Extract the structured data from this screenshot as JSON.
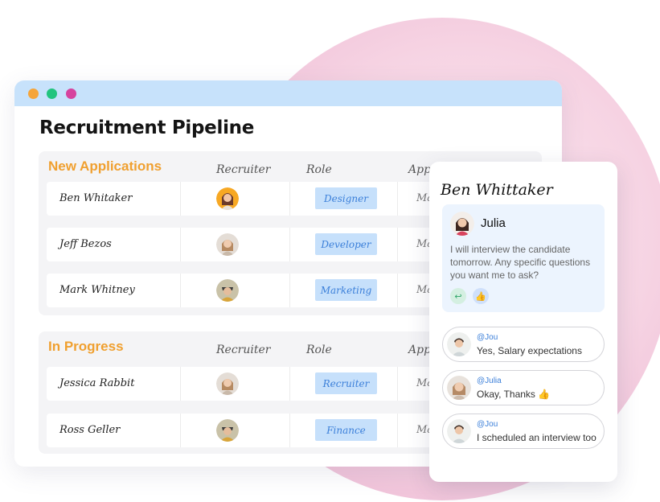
{
  "window": {
    "title": "Recruitment Pipeline",
    "colors": {
      "titlebar": "#c7e2fb",
      "dots": [
        "#f5a53a",
        "#22c47e",
        "#d6439e"
      ]
    }
  },
  "columns": {
    "recruiter": "Recruiter",
    "role": "Role",
    "date": "App"
  },
  "sections": [
    {
      "title": "New Applications",
      "rows": [
        {
          "name": "Ben Whitaker",
          "role": "Designer",
          "date": "May"
        },
        {
          "name": "Jeff Bezos",
          "role": "Developer",
          "date": "May"
        },
        {
          "name": "Mark Whitney",
          "role": "Marketing",
          "date": "May"
        }
      ]
    },
    {
      "title": "In Progress",
      "rows": [
        {
          "name": "Jessica Rabbit",
          "role": "Recruiter",
          "date": "May"
        },
        {
          "name": "Ross Geller",
          "role": "Finance",
          "date": "May"
        }
      ]
    }
  ],
  "detail": {
    "candidate": "Ben Whittaker",
    "comment": {
      "author": "Julia",
      "text": "I will interview the candidate tomorrow. Any specific questions you want me to ask?",
      "actions": [
        "reply-icon",
        "thumbs-up-icon"
      ]
    },
    "replies": [
      {
        "user": "@Jou",
        "text": "Yes,  Salary expectations"
      },
      {
        "user": "@Julia",
        "text": "Okay, Thanks 👍"
      },
      {
        "user": "@Jou",
        "text": "I scheduled an interview too"
      }
    ]
  },
  "accent": {
    "section_title": "#f0a030",
    "badge_bg": "#c6e0fb",
    "badge_text": "#3b7fd9"
  }
}
